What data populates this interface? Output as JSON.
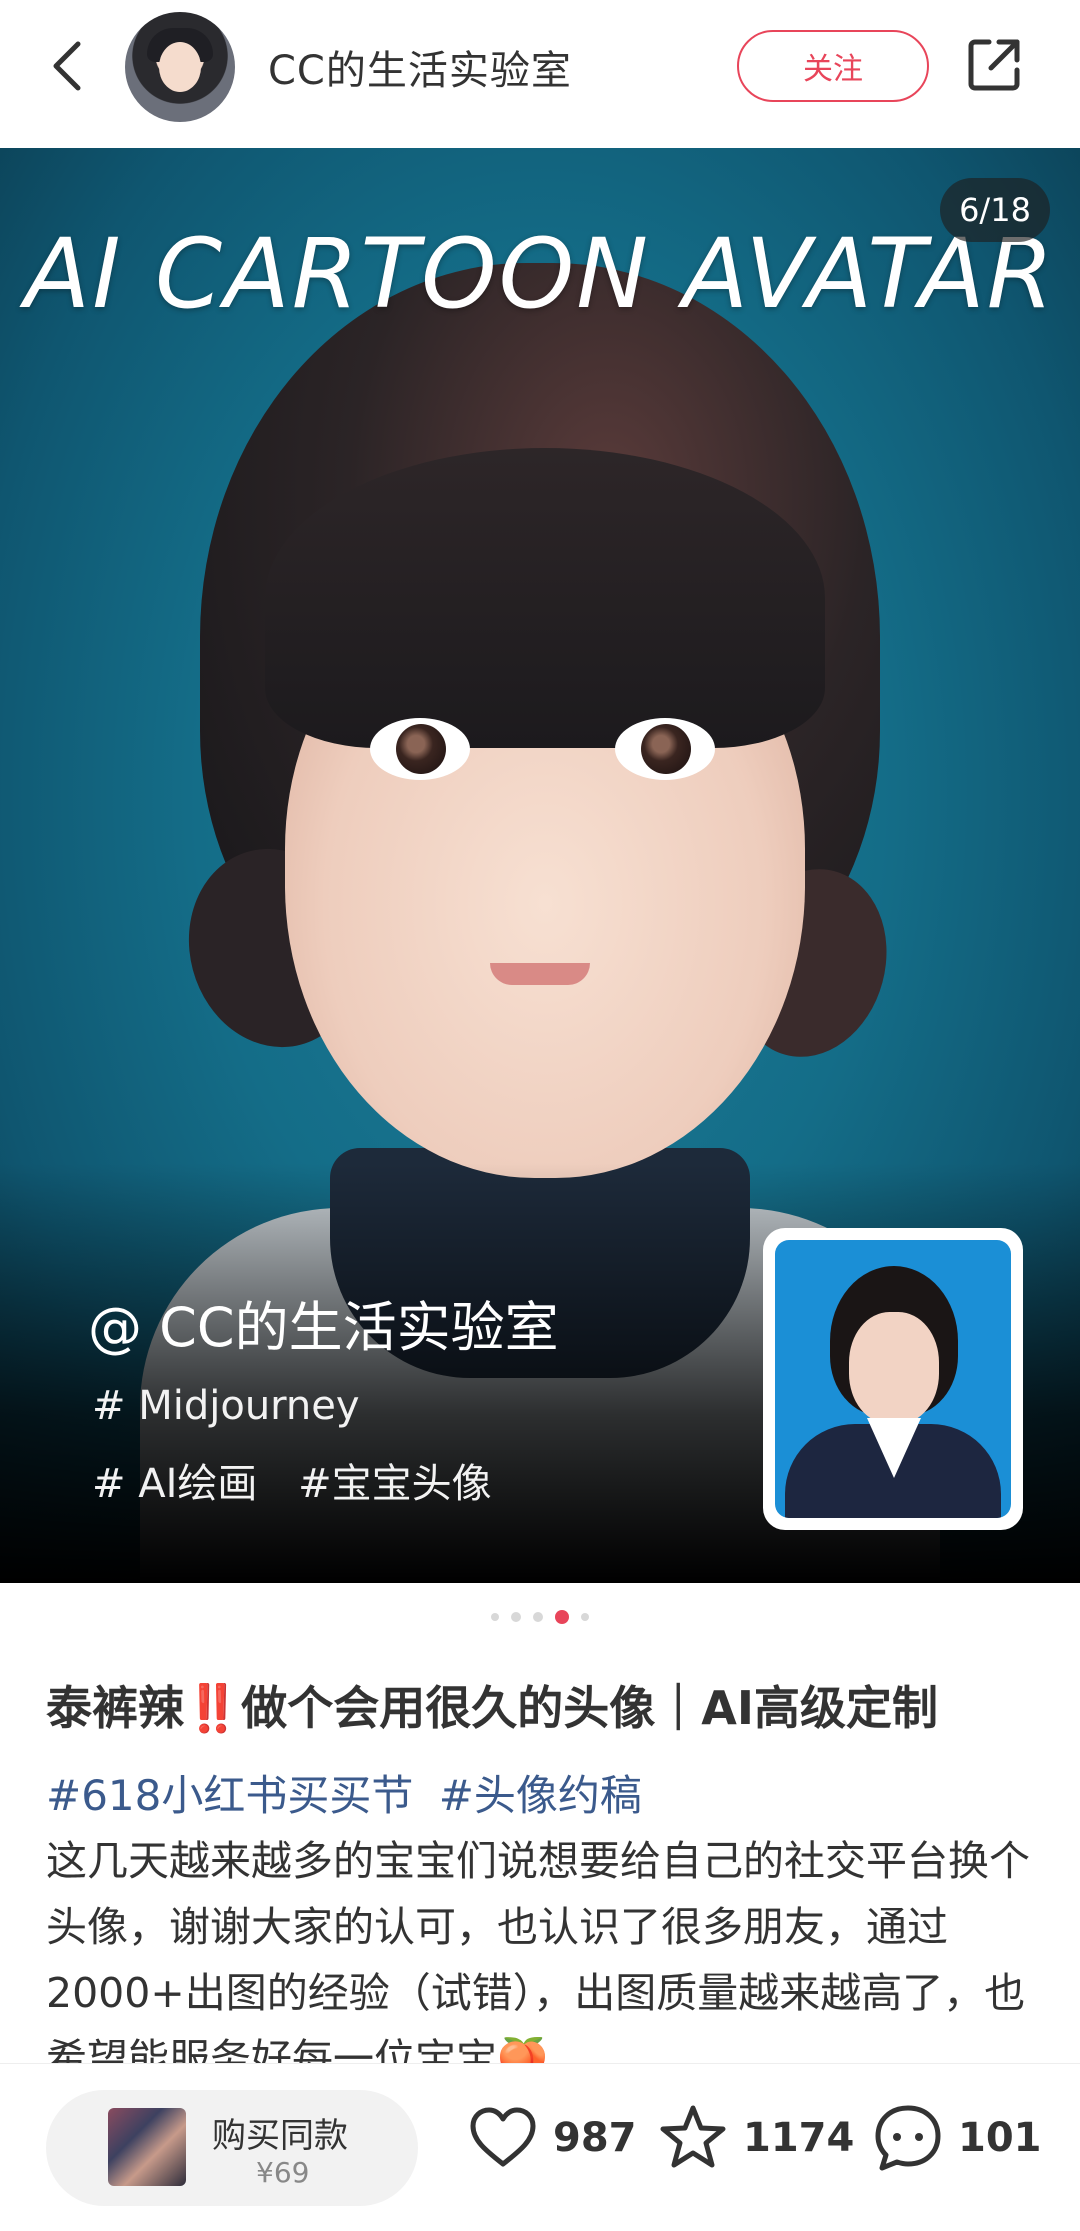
{
  "header": {
    "username": "CC的生活实验室",
    "follow_label": "关注"
  },
  "hero": {
    "title": "AI CARTOON AVATAR",
    "page_counter": "6/18",
    "watermark": "@ CC的生活实验室",
    "tag_line_1": "# Midjourney",
    "tag_line_2": [
      "# AI绘画",
      "#宝宝头像"
    ]
  },
  "carousel": {
    "dot_count": 5,
    "active_index": 3
  },
  "post": {
    "title_part1": "泰裤辣",
    "title_bang": "‼️",
    "title_part2": "做个会用很久的头像｜AI高级定制",
    "tags": [
      "#618小红书买买节",
      "#头像约稿"
    ],
    "body": "这几天越来越多的宝宝们说想要给自己的社交平台换个头像，谢谢大家的认可，也认识了很多朋友，通过2000+出图的经验（试错），出图质量越来越高了，也希望能服务好每一位宝宝🍑"
  },
  "bottom_bar": {
    "buy_label": "购买同款",
    "buy_price": "¥69",
    "likes": "987",
    "favorites": "1174",
    "comments": "101"
  },
  "colors": {
    "accent": "#e8455a",
    "tag_blue": "#3b5a8c"
  },
  "icons": [
    "back-icon",
    "share-icon",
    "heart-icon",
    "star-icon",
    "comment-icon"
  ]
}
